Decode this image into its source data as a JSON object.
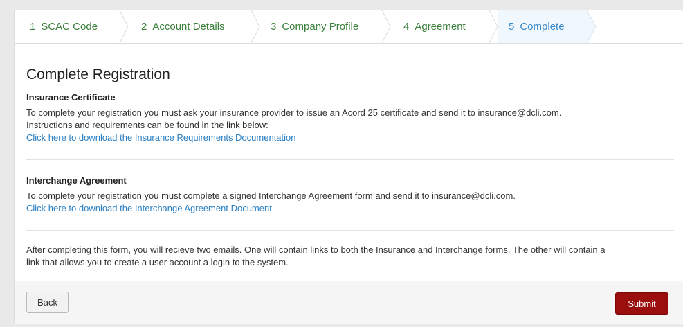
{
  "wizard": {
    "steps": [
      {
        "num": "1",
        "label": "SCAC Code"
      },
      {
        "num": "2",
        "label": "Account Details"
      },
      {
        "num": "3",
        "label": "Company Profile"
      },
      {
        "num": "4",
        "label": "Agreement"
      },
      {
        "num": "5",
        "label": "Complete"
      }
    ],
    "active_step": "5"
  },
  "page": {
    "title": "Complete Registration"
  },
  "insurance": {
    "heading": "Insurance Certificate",
    "line1": "To complete your registration you must ask your insurance provider to issue an Acord 25 certificate and send it to insurance@dcli.com.",
    "line2": "Instructions and requirements can be found in the link below:",
    "link": "Click here to download the Insurance Requirements Documentation"
  },
  "interchange": {
    "heading": "Interchange Agreement",
    "line1": "To complete your registration you must complete a signed Interchange Agreement form and send it to insurance@dcli.com.",
    "link": "Click here to download the Interchange Agreement Document"
  },
  "note": {
    "line1": "After completing this form, you will recieve two emails. One will contain links to both the Insurance and Interchange forms. The other will contain a",
    "line2": "link that allows you to create a user account a login to the system."
  },
  "footer": {
    "back_label": "Back",
    "submit_label": "Submit"
  },
  "colors": {
    "step_text": "#3a7f3a",
    "active_step_text": "#3a87c8",
    "link": "#2a7fc2",
    "submit_bg": "#9a0e0e"
  }
}
